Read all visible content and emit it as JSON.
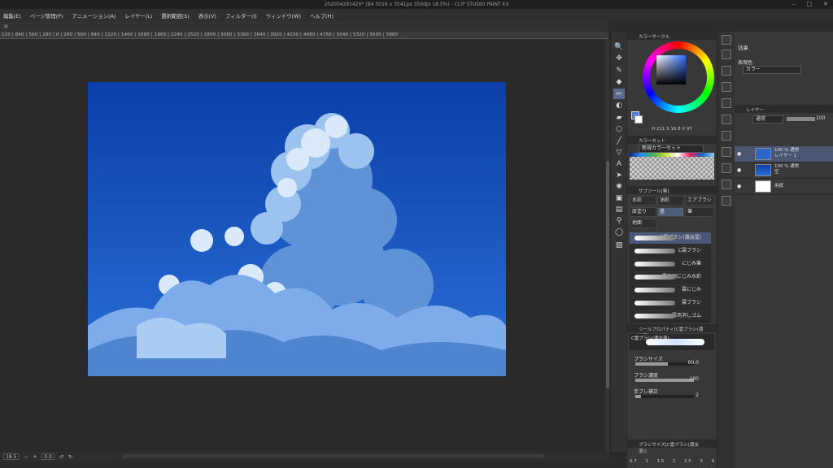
{
  "window": {
    "title": "202004291420* (B4 5016 x 3541px 350dpi 18.5%) - CLIP STUDIO PAINT EX",
    "controls": [
      "–",
      "□",
      "✕"
    ]
  },
  "menu": [
    "編集(E)",
    "ページ管理(P)",
    "アニメーション(A)",
    "レイヤー(L)",
    "選択範囲(S)",
    "表示(V)",
    "フィルター(I)",
    "ウィンドウ(W)",
    "ヘルプ(H)"
  ],
  "ruler": {
    "ticks": [
      "120",
      "840",
      "560",
      "280",
      "0",
      "280",
      "560",
      "840",
      "1120",
      "1400",
      "1680",
      "1960",
      "2240",
      "2520",
      "2800",
      "3080",
      "3360",
      "3640",
      "3920",
      "4200",
      "4480",
      "4760",
      "5040",
      "5320",
      "5600",
      "5880"
    ]
  },
  "status": {
    "zoom": "18.5",
    "angle": "0.0"
  },
  "color_panel": {
    "title": "カラーサークル",
    "values": "H 211  S 16.8  V 97"
  },
  "color_set": {
    "title": "カラーセット",
    "set_name": "新規カラーセット"
  },
  "sub_tool": {
    "title": "サブツール[筆]",
    "categories": [
      "水彩",
      "油彩",
      "エアブラシ",
      "厚塗り",
      "墨",
      "筆",
      "地面"
    ],
    "brushes": [
      "C雲ブラシ(濃淡混)",
      "C雲ブラシ",
      "にじみ筆",
      "雪表現にじみ水彩",
      "雲にじみ",
      "雲ブラシ",
      "雲用消しゴム"
    ]
  },
  "tool_property": {
    "title": "ツールプロパティ[C雲ブラシ(濃淡混)]",
    "brush_name": "C雲ブラシ(濃淡混)",
    "brush_size_label": "ブラシサイズ",
    "brush_size_value": "60.0",
    "brush_size_fraction": 0.55,
    "density_label": "ブラシ濃度",
    "density_value": "100",
    "density_fraction": 1.0,
    "stabilization_label": "手ブレ補正",
    "stabilization_value": "2",
    "stabilization_fraction": 0.1
  },
  "brush_size_panel": {
    "title": "ブラシサイズ[C雲ブラシ(濃淡混)]",
    "values": [
      "0.7",
      "1",
      "1.5",
      "2",
      "2.5",
      "3",
      "4"
    ]
  },
  "effects": {
    "title": "効果",
    "expression_label": "表現色",
    "expression_value": "カラー"
  },
  "layers": {
    "title": "レイヤー",
    "blend_mode": "通常",
    "opacity": "100",
    "items": [
      {
        "line1": "100 % 通常",
        "line2": "レイヤー 1"
      },
      {
        "line1": "100 % 通常",
        "line2": "空"
      },
      {
        "line1": "",
        "line2": "用紙"
      }
    ]
  }
}
